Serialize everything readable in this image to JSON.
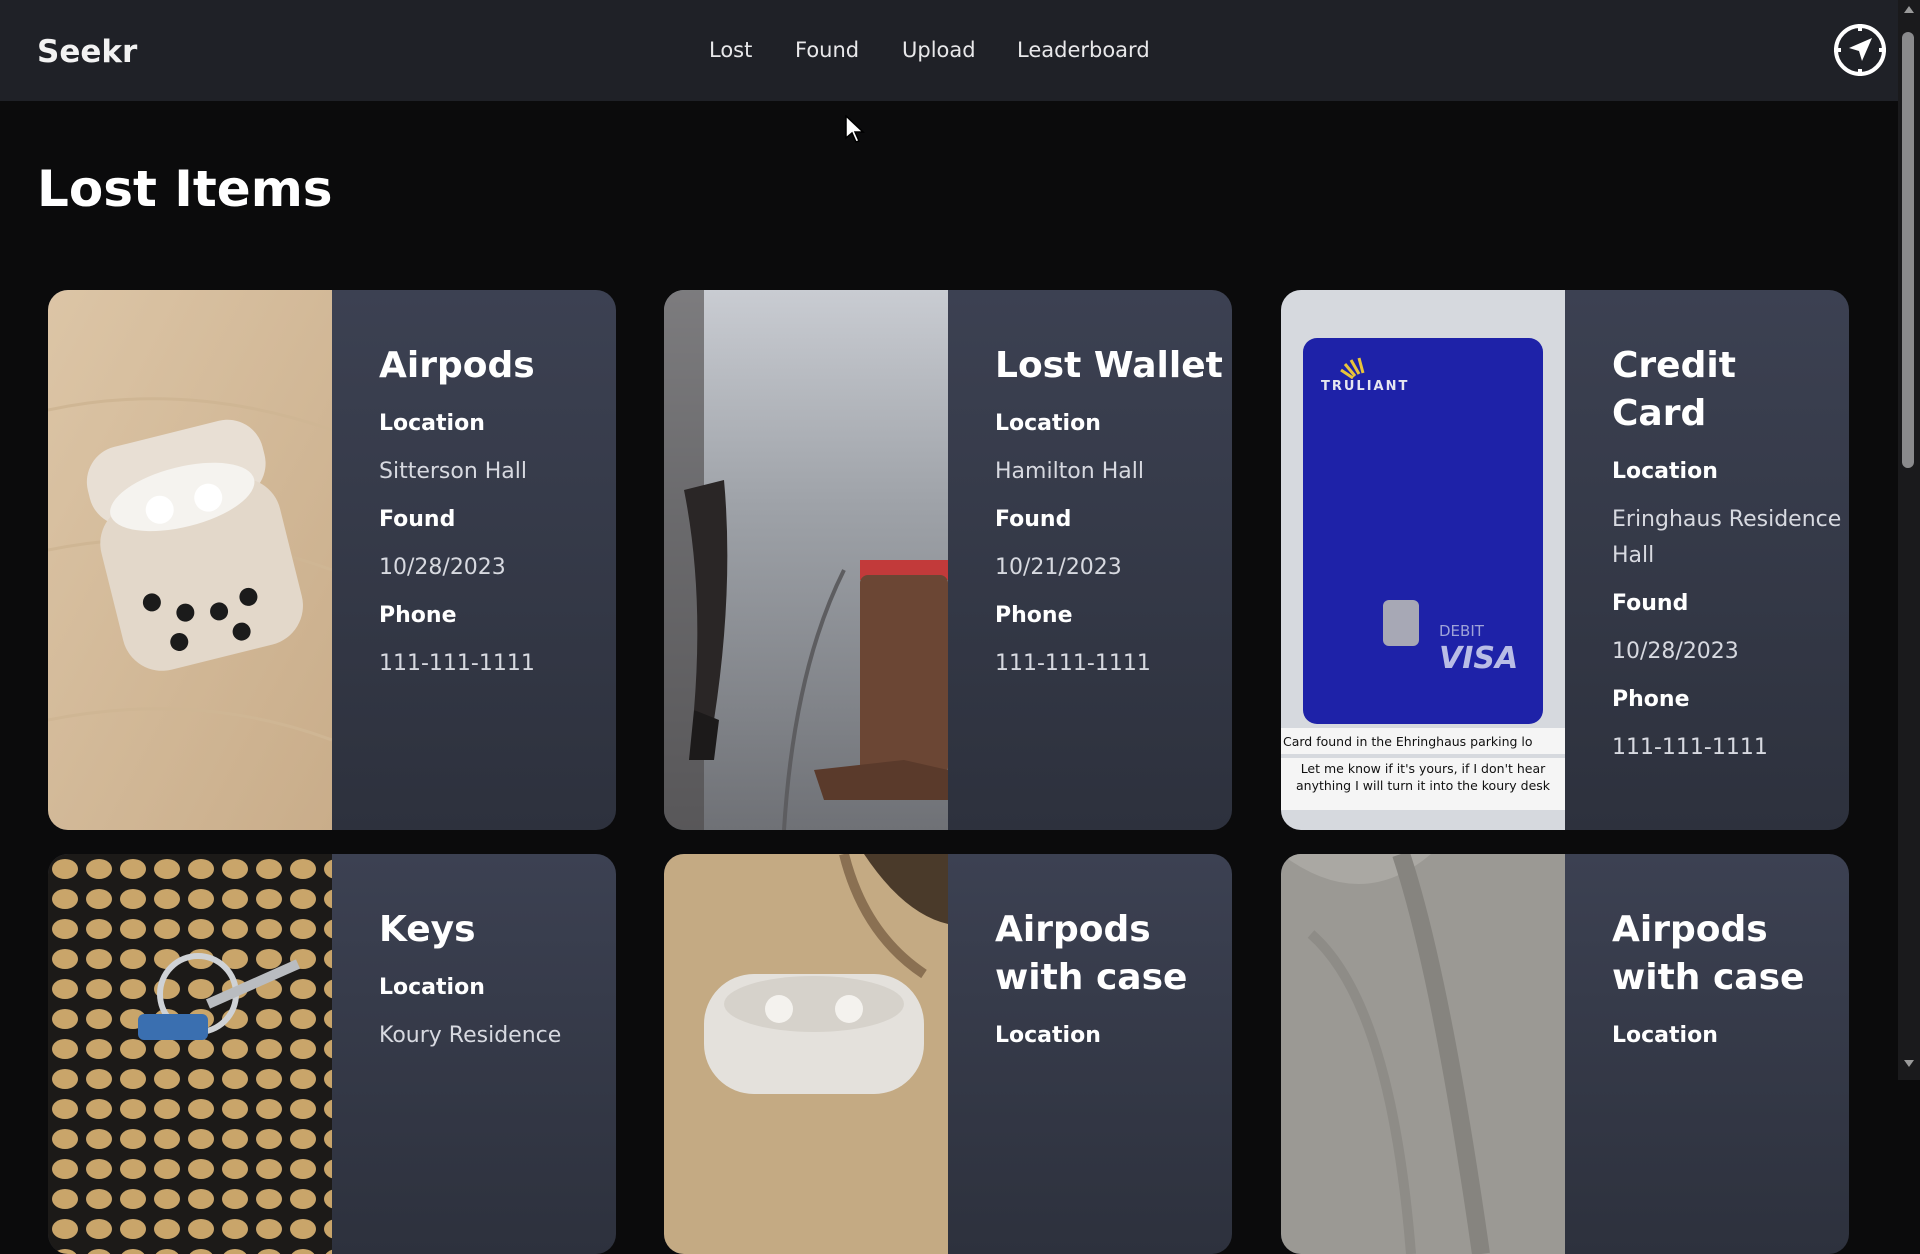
{
  "app": {
    "brand": "Seekr"
  },
  "nav": {
    "links": [
      "Lost",
      "Found",
      "Upload",
      "Leaderboard"
    ],
    "profile_icon": "compass-icon"
  },
  "page": {
    "title": "Lost Items"
  },
  "labels": {
    "location": "Location",
    "found": "Found",
    "phone": "Phone"
  },
  "cards": [
    {
      "title": "Airpods",
      "location": "Sitterson Hall",
      "found": "10/28/2023",
      "phone": "111-111-1111",
      "image": "airpods-case-photo"
    },
    {
      "title": "Lost Wallet",
      "location": "Hamilton Hall",
      "found": "10/21/2023",
      "phone": "111-111-1111",
      "image": "wallet-on-street-photo"
    },
    {
      "title": "Credit Card",
      "location": "Eringhaus Residence Hall",
      "found": "10/28/2023",
      "phone": "111-111-1111",
      "image": "credit-card-photo",
      "image_text": {
        "card_brand": "TRULIANT",
        "card_type": "DEBIT",
        "network": "VISA",
        "caption_1": "Card found in the Ehringhaus parking lo",
        "caption_2": "Let me know if it's yours, if I don't hear anything I will turn it into the koury desk"
      }
    },
    {
      "title": "Keys",
      "location": "Koury Residence",
      "image": "keys-on-mesh-photo"
    },
    {
      "title": "Airpods with case",
      "image": "airpods-with-case-photo"
    },
    {
      "title": "Airpods with case",
      "image": "airpods-on-fabric-photo"
    }
  ],
  "colors": {
    "navbar_bg": "#1f2127",
    "page_bg": "#0b0b0c",
    "card_top": "#3c4152",
    "card_bottom": "#2d313d"
  }
}
